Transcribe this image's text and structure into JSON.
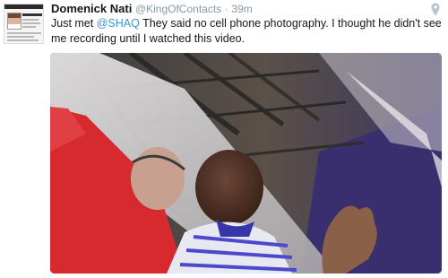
{
  "tweet": {
    "author_name": "Domenick Nati",
    "handle": "@KingOfContacts",
    "separator": "·",
    "time": "39m",
    "text_before": "Just met ",
    "mention": "@SHAQ",
    "text_after": " They said no cell phone photography. I thought he didn't see me recording until I watched this video.",
    "avatar_icon": "profile-thumbnail-icon",
    "location_icon": "map-pin-icon",
    "colors": {
      "name": "#14171a",
      "meta": "#8899a6",
      "mention": "#3b94d9",
      "pin": "#b8c4cc"
    }
  }
}
